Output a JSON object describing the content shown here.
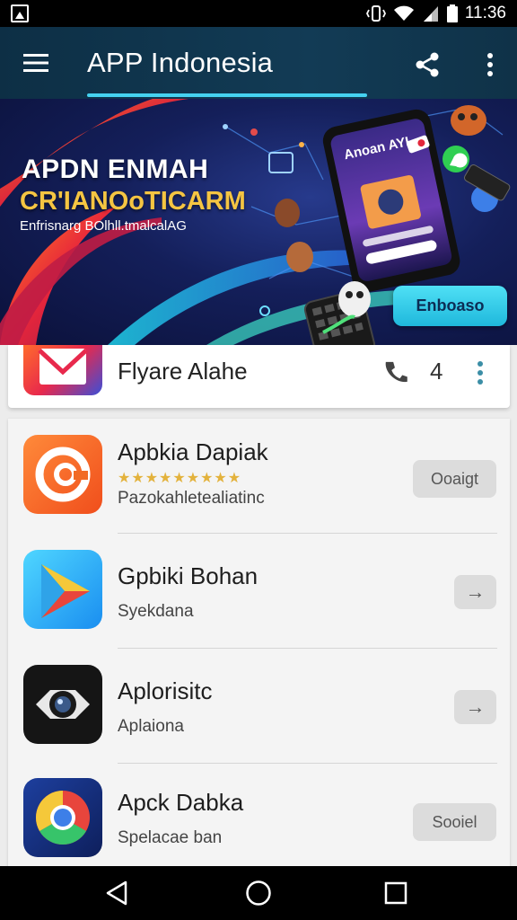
{
  "status_bar": {
    "time": "11:36",
    "icons": [
      "notification-icon",
      "vibrate-icon",
      "wifi-icon",
      "signal-icon",
      "battery-icon"
    ]
  },
  "app_bar": {
    "title": "APP Indonesia",
    "icons": [
      "menu-icon",
      "share-icon",
      "more-vert-icon"
    ],
    "accent": "#45d2f0"
  },
  "banner": {
    "headline": "APDN ENMAH",
    "subheadline": "CR'IANOoTICARM",
    "tagline": "Enfrisnarg BOlhll.tmalcalAG",
    "cta_label": "Enboaso",
    "phone_screen_text": "Anoan AYL",
    "colors": {
      "headline": "#ffffff",
      "subheadline": "#f5c542",
      "cta": "#2ec6e6"
    }
  },
  "featured": {
    "name": "Flyare Alahe",
    "count": "4",
    "icons": [
      "mail-icon",
      "phone-icon",
      "more-vert-icon"
    ]
  },
  "apps": [
    {
      "name": "Apbkia Dapiak",
      "rating": "★★★★★★★★★",
      "subtitle": "Pazokahletealiatinc",
      "button": "Ooaigt",
      "icon": "swirl-app-icon"
    },
    {
      "name": "Gpbiki Bohan",
      "subtitle": "Syekdana",
      "button": "→",
      "icon": "play-triangle-icon"
    },
    {
      "name": "Aplorisitc",
      "subtitle": "Aplaiona",
      "button": "→",
      "icon": "camera-icon"
    },
    {
      "name": "Apck Dabka",
      "subtitle": "Spelacae ban",
      "button": "Sooiel",
      "icon": "chrome-icon"
    }
  ],
  "nav_bar": {
    "icons": [
      "back-icon",
      "home-icon",
      "recents-icon"
    ]
  }
}
